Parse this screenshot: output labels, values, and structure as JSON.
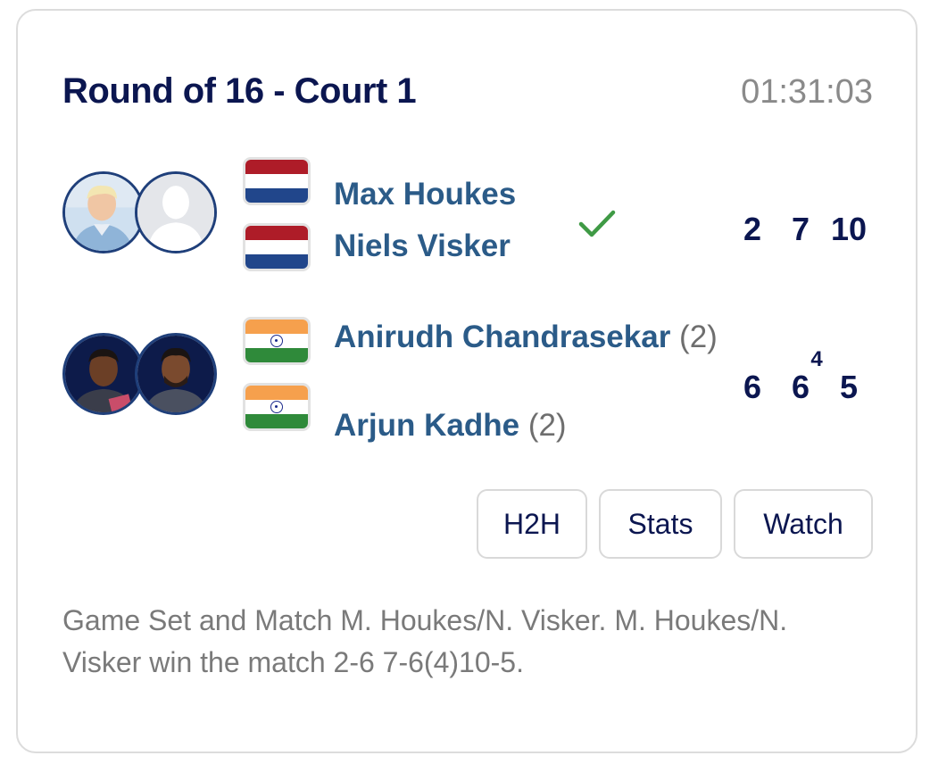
{
  "match": {
    "title": "Round of 16 - Court 1",
    "duration": "01:31:03"
  },
  "teams": [
    {
      "players": [
        {
          "name": "Max Houkes",
          "seed": "",
          "flag": "Netherlands",
          "avatar": "photo"
        },
        {
          "name": "Niels Visker",
          "seed": "",
          "flag": "Netherlands",
          "avatar": "silhouette"
        }
      ],
      "winner": true,
      "scores": [
        "2",
        "7",
        "10"
      ],
      "tiebreaks": [
        "",
        "",
        ""
      ]
    },
    {
      "players": [
        {
          "name": "Anirudh Chandrasekar",
          "seed": "(2)",
          "flag": "India",
          "avatar": "photo"
        },
        {
          "name": "Arjun Kadhe",
          "seed": "(2)",
          "flag": "India",
          "avatar": "photo"
        }
      ],
      "winner": false,
      "scores": [
        "6",
        "6",
        "5"
      ],
      "tiebreaks": [
        "",
        "4",
        ""
      ]
    }
  ],
  "buttons": {
    "h2h": "H2H",
    "stats": "Stats",
    "watch": "Watch"
  },
  "summary": "Game Set and Match M. Houkes/N. Visker. M. Houkes/N. Visker win the match 2-6 7-6(4)10-5.",
  "colors": {
    "title": "#0b1650",
    "player_name": "#2b5b88",
    "muted": "#7a7a7a",
    "winner_check": "#3f9a45",
    "flag_nl": [
      "#ae1c28",
      "#ffffff",
      "#21468b"
    ],
    "flag_in": [
      "#ff9933",
      "#ffffff",
      "#138808"
    ]
  },
  "icons": {
    "winner": "checkmark-icon"
  }
}
